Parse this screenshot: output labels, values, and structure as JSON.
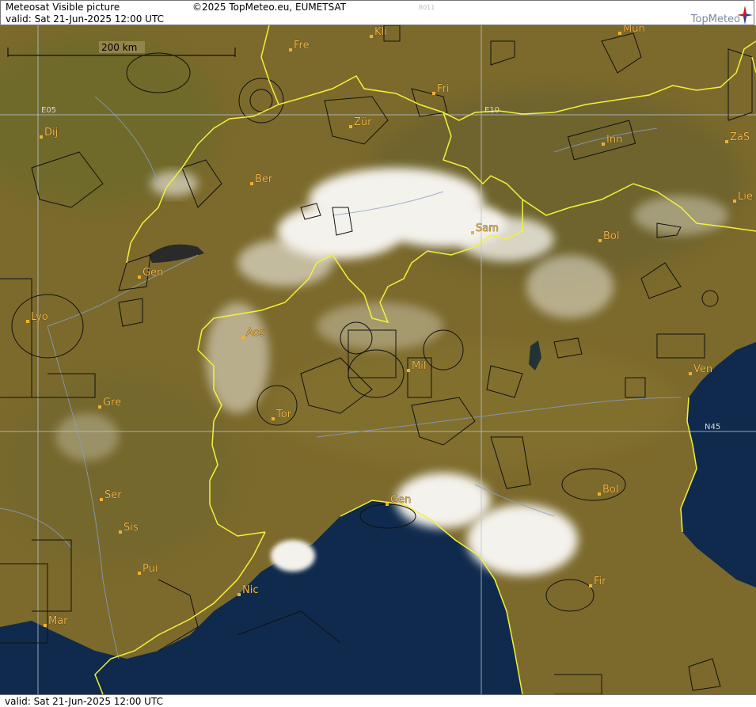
{
  "header": {
    "title": "Meteosat Visible picture",
    "valid": "valid:  Sat  21-Jun-2025  12:00 UTC",
    "copyright": "©2025 TopMeteo.eu, EUMETSAT",
    "code": "8011",
    "logo": "TopMeteo"
  },
  "footer": {
    "valid": "valid:  Sat  21-Jun-2025  12:00 UTC"
  },
  "scale": {
    "label": "200 km"
  },
  "grid": {
    "e05": "E05",
    "e10": "E10",
    "n45": "N45"
  },
  "colors": {
    "land": "#7c6a2c",
    "sea": "#0f2a4c",
    "border": "#f2f23a",
    "cloud": "#f4f2ec"
  },
  "cities": [
    {
      "name": "Kli"
    },
    {
      "name": "Mün"
    },
    {
      "name": "Fre"
    },
    {
      "name": "Fri"
    },
    {
      "name": "Zür"
    },
    {
      "name": "Dij"
    },
    {
      "name": "Inn"
    },
    {
      "name": "ZaS"
    },
    {
      "name": "Ber"
    },
    {
      "name": "Lie"
    },
    {
      "name": "Sam"
    },
    {
      "name": "Bol"
    },
    {
      "name": "Gen"
    },
    {
      "name": "Lyo"
    },
    {
      "name": "Aos"
    },
    {
      "name": "Mil"
    },
    {
      "name": "Ven"
    },
    {
      "name": "Gre"
    },
    {
      "name": "Tor"
    },
    {
      "name": "Ser"
    },
    {
      "name": "Bol"
    },
    {
      "name": "Gen"
    },
    {
      "name": "Sis"
    },
    {
      "name": "Pui"
    },
    {
      "name": "Nic"
    },
    {
      "name": "Fir"
    },
    {
      "name": "Mar"
    }
  ]
}
